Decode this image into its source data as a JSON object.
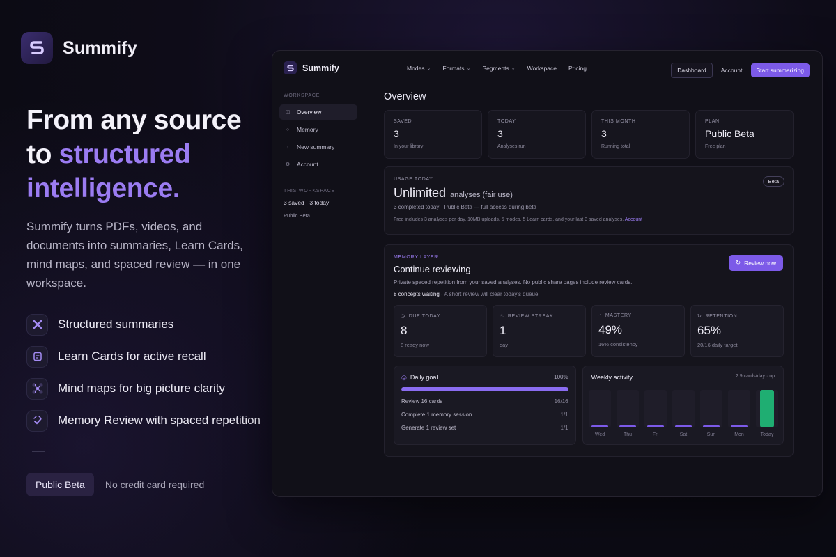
{
  "hero": {
    "brand": "Summify",
    "title_line1": "From any source",
    "title_line2_prefix": "to ",
    "title_line2_accent": "structured",
    "title_line3": "intelligence.",
    "subtitle": "Summify turns PDFs, videos, and documents into summaries, Learn Cards, mind maps, and spaced review — in one workspace.",
    "features": [
      {
        "label": "Structured summaries",
        "icon": "structure-icon"
      },
      {
        "label": "Learn Cards for active recall",
        "icon": "card-icon"
      },
      {
        "label": "Mind maps for big picture clarity",
        "icon": "mindmap-icon"
      },
      {
        "label": "Memory Review with spaced repetition",
        "icon": "memory-icon"
      }
    ],
    "beta_badge": "Public Beta",
    "beta_note": "No credit card required"
  },
  "app": {
    "brand": "Summify",
    "nav": {
      "modes": "Modes",
      "formats": "Formats",
      "segments": "Segments",
      "workspace": "Workspace",
      "pricing": "Pricing"
    },
    "dashboard": "Dashboard",
    "account": "Account",
    "start": "Start summarizing",
    "sidebar": {
      "heading": "WORKSPACE",
      "items": [
        {
          "label": "Overview"
        },
        {
          "label": "Memory"
        },
        {
          "label": "New summary"
        },
        {
          "label": "Account"
        }
      ],
      "ws_heading": "THIS WORKSPACE",
      "ws_value": "3 saved · 3 today",
      "ws_sub": "Public Beta"
    },
    "overview_title": "Overview",
    "stats": [
      {
        "label": "SAVED",
        "value": "3",
        "sub": "In your library"
      },
      {
        "label": "TODAY",
        "value": "3",
        "sub": "Analyses run"
      },
      {
        "label": "THIS MONTH",
        "value": "3",
        "sub": "Running total"
      },
      {
        "label": "PLAN",
        "value": "Public Beta",
        "sub": "Free plan"
      }
    ],
    "usage": {
      "label": "USAGE TODAY",
      "big": "Unlimited",
      "big_suffix": "analyses (fair use)",
      "line1": "3 completed today · Public Beta — full access during beta",
      "line2": "Free includes 3 analyses per day, 10MB uploads, 5 modes, 5 Learn cards, and your last 3 saved analyses.",
      "link": "Account",
      "pill": "Beta"
    },
    "memory": {
      "label": "MEMORY LAYER",
      "title": "Continue reviewing",
      "desc": "Private spaced repetition from your saved analyses. No public share pages include review cards.",
      "waiting_bold": "8 concepts waiting",
      "waiting_rest": " · A short review will clear today's queue.",
      "review_btn": "Review now",
      "stats": [
        {
          "label": "DUE TODAY",
          "value": "8",
          "sub": "8 ready now",
          "icon": "clock-icon"
        },
        {
          "label": "REVIEW STREAK",
          "value": "1",
          "sub": "day",
          "icon": "flame-icon"
        },
        {
          "label": "MASTERY",
          "value": "49%",
          "sub": "16% consistency",
          "icon": "gauge-icon"
        },
        {
          "label": "RETENTION",
          "value": "65%",
          "sub": "20/16 daily target",
          "icon": "refresh-icon"
        }
      ]
    },
    "goal": {
      "title": "Daily goal",
      "pct": "100%",
      "progress": 1.0,
      "rows": [
        {
          "label": "Review 16 cards",
          "n": "16/16"
        },
        {
          "label": "Complete 1 memory session",
          "n": "1/1"
        },
        {
          "label": "Generate 1 review set",
          "n": "1/1"
        }
      ]
    },
    "weekly": {
      "title": "Weekly activity",
      "note": "2.9 cards/day · up",
      "days": [
        "Wed",
        "Thu",
        "Fri",
        "Sat",
        "Sun",
        "Mon",
        "Today"
      ],
      "values": [
        0.04,
        0.04,
        0.04,
        0.04,
        0.04,
        0.04,
        1.0
      ],
      "bar_color": "#7c5ae8",
      "today_color": "#1fae72"
    }
  }
}
